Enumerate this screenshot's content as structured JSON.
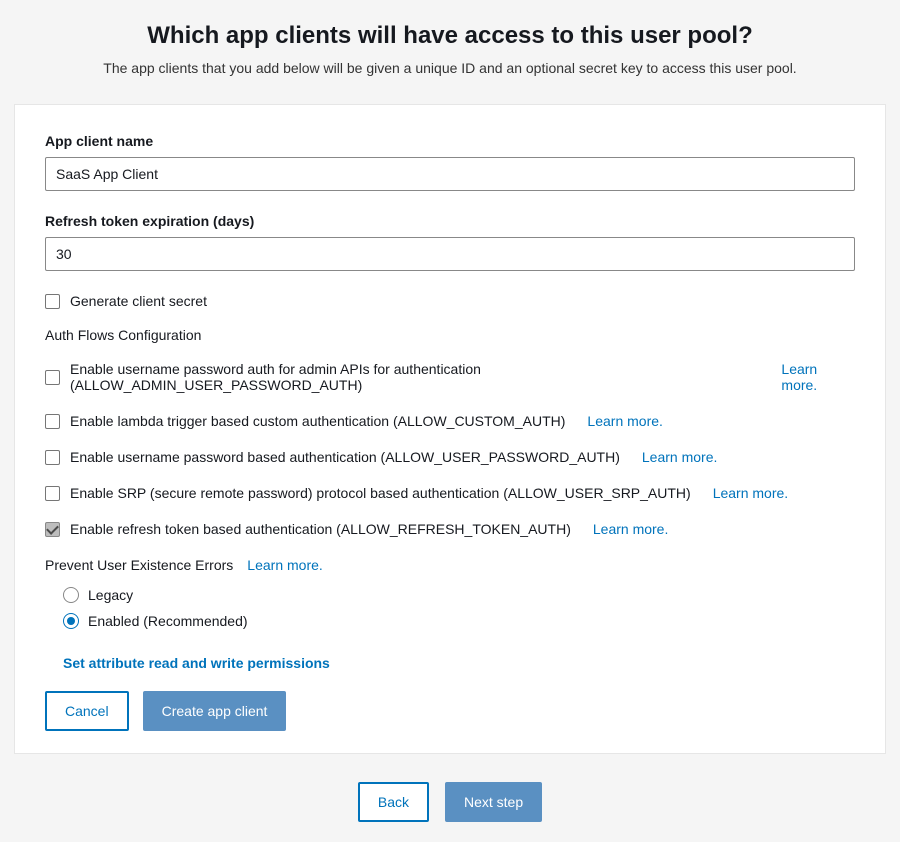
{
  "page": {
    "title": "Which app clients will have access to this user pool?",
    "subtitle": "The app clients that you add below will be given a unique ID and an optional secret key to access this user pool."
  },
  "fields": {
    "appClientName": {
      "label": "App client name",
      "value": "SaaS App Client"
    },
    "refreshTokenExpiration": {
      "label": "Refresh token expiration (days)",
      "value": "30"
    }
  },
  "generateClientSecret": {
    "label": "Generate client secret",
    "checked": false
  },
  "authFlowsHeading": "Auth Flows Configuration",
  "learnMoreText": "Learn more.",
  "flows": [
    {
      "label": "Enable username password auth for admin APIs for authentication (ALLOW_ADMIN_USER_PASSWORD_AUTH)",
      "checked": false
    },
    {
      "label": "Enable lambda trigger based custom authentication (ALLOW_CUSTOM_AUTH)",
      "checked": false
    },
    {
      "label": "Enable username password based authentication (ALLOW_USER_PASSWORD_AUTH)",
      "checked": false
    },
    {
      "label": "Enable SRP (secure remote password) protocol based authentication (ALLOW_USER_SRP_AUTH)",
      "checked": false
    },
    {
      "label": "Enable refresh token based authentication (ALLOW_REFRESH_TOKEN_AUTH)",
      "checked": true
    }
  ],
  "preventErrors": {
    "heading": "Prevent User Existence Errors",
    "options": {
      "legacy": "Legacy",
      "enabled": "Enabled (Recommended)"
    },
    "selected": "enabled"
  },
  "attrLink": "Set attribute read and write permissions",
  "buttons": {
    "cancel": "Cancel",
    "createAppClient": "Create app client",
    "back": "Back",
    "nextStep": "Next step"
  }
}
